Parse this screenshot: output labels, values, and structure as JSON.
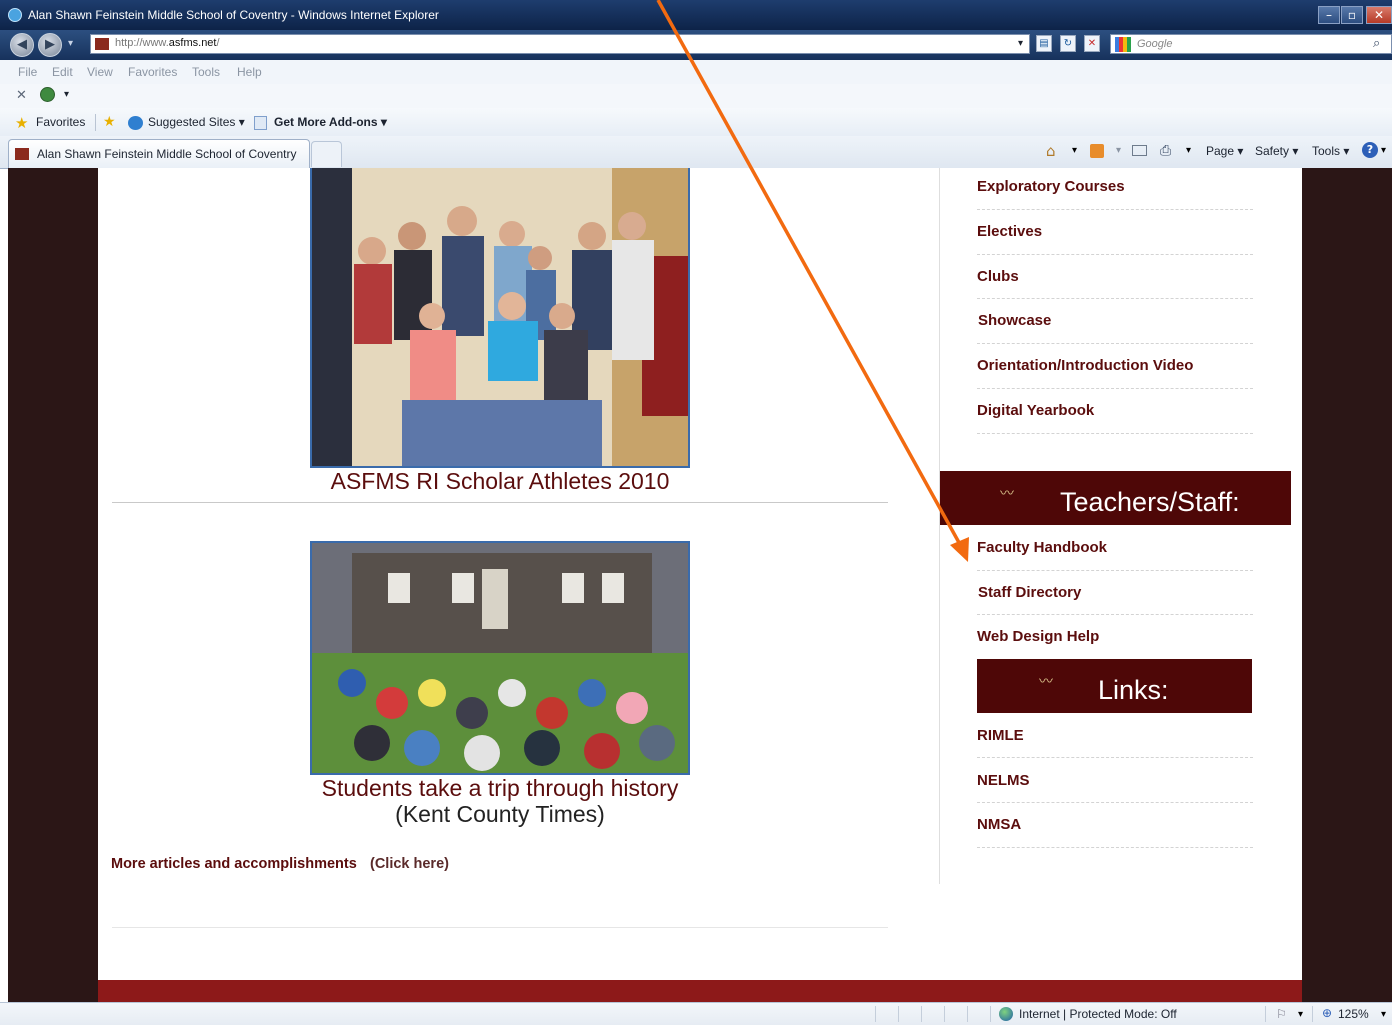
{
  "window": {
    "title": "Alan Shawn Feinstein Middle School of Coventry - Windows Internet Explorer"
  },
  "address": {
    "url_prefix": "http://www.",
    "url_domain": "asfms.net",
    "url_suffix": "/"
  },
  "search": {
    "placeholder": "Google"
  },
  "menu": [
    "File",
    "Edit",
    "View",
    "Favorites",
    "Tools",
    "Help"
  ],
  "favorites_bar": {
    "favorites": "Favorites",
    "suggested": "Suggested Sites ▾",
    "addons": "Get More Add-ons ▾"
  },
  "tab": {
    "title": "Alan Shawn Feinstein Middle School of Coventry"
  },
  "command_bar": {
    "page": "Page ▾",
    "safety": "Safety ▾",
    "tools": "Tools ▾"
  },
  "content": {
    "story1_caption": "ASFMS RI Scholar Athletes 2010",
    "story2_caption": "Students take a trip through history",
    "story2_source": "(Kent County Times)",
    "more_link": "More articles and accomplishments",
    "click_here": "(Click here)"
  },
  "sidebar": {
    "student_links": [
      "Exploratory Courses",
      "Electives",
      "Clubs",
      "Showcase",
      "Orientation/Introduction Video",
      "Digital Yearbook"
    ],
    "teachers_header": "Teachers/Staff:",
    "teacher_links": [
      "Faculty Handbook",
      "Staff Directory",
      "Web Design Help"
    ],
    "links_header": "Links:",
    "external_links": [
      "RIMLE",
      "NELMS",
      "NMSA"
    ]
  },
  "status": {
    "zone": "Internet | Protected Mode: Off",
    "zoom": "125%"
  },
  "colors": {
    "accent": "#4e0707",
    "link": "#5b0d0d",
    "annotation_arrow": "#f26a10"
  }
}
